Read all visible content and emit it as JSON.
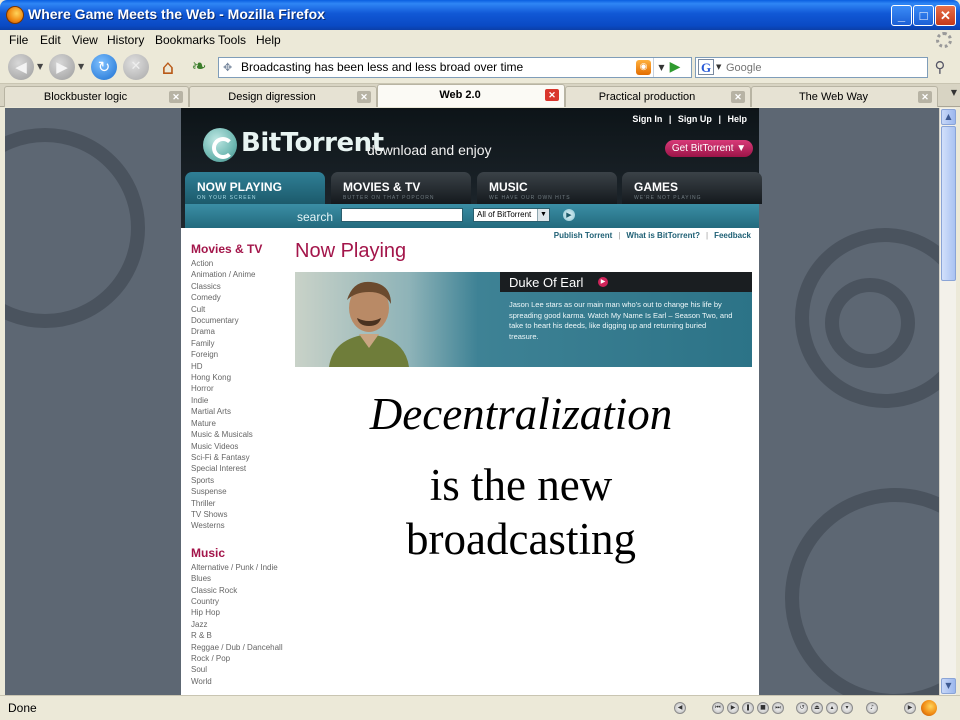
{
  "window": {
    "title": "Where Game Meets the Web - Mozilla Firefox",
    "minimize": "_",
    "maximize": "□",
    "close": "✕"
  },
  "menu": [
    "File",
    "Edit",
    "View",
    "History",
    "Bookmarks",
    "Tools",
    "Help"
  ],
  "toolbar": {
    "url": "Broadcasting has been less and less broad over time",
    "search_placeholder": "Google",
    "search_engine_letter": "G"
  },
  "tabs": [
    {
      "label": "Blockbuster logic",
      "active": false
    },
    {
      "label": "Design digression",
      "active": false
    },
    {
      "label": "Web 2.0",
      "active": true
    },
    {
      "label": "Practical production",
      "active": false
    },
    {
      "label": "The Web Way",
      "active": false
    }
  ],
  "site": {
    "toplinks": [
      "Sign In",
      "|",
      "Sign Up",
      "|",
      "Help"
    ],
    "logo_main": "BitTorrent",
    "tagline": "download and enjoy",
    "get_button": "Get BitTorrent ▼",
    "nav": [
      {
        "label": "NOW PLAYING",
        "sub": "On your screen",
        "active": true
      },
      {
        "label": "MOVIES & TV",
        "sub": "Butter on that popcorn",
        "active": false
      },
      {
        "label": "MUSIC",
        "sub": "We have our own hits",
        "active": false
      },
      {
        "label": "GAMES",
        "sub": "We're not playing",
        "active": false
      }
    ],
    "search_label": "search",
    "search_scope": "All of BitTorrent",
    "sublinks": [
      "Publish Torrent",
      "What is BitTorrent?",
      "Feedback"
    ],
    "sidebar": {
      "movies_heading": "Movies & TV",
      "movies": [
        "Action",
        "Animation / Anime",
        "Classics",
        "Comedy",
        "Cult",
        "Documentary",
        "Drama",
        "Family",
        "Foreign",
        "HD",
        "Hong Kong",
        "Horror",
        "Indie",
        "Martial Arts",
        "Mature",
        "Music & Musicals",
        "Music Videos",
        "Sci-Fi & Fantasy",
        "Special Interest",
        "Sports",
        "Suspense",
        "Thriller",
        "TV Shows",
        "Westerns"
      ],
      "music_heading": "Music",
      "music": [
        "Alternative / Punk / Indie",
        "Blues",
        "Classic Rock",
        "Country",
        "Hip Hop",
        "Jazz",
        "R & B",
        "Reggae / Dub / Dancehall",
        "Rock / Pop",
        "Soul",
        "World"
      ]
    },
    "now_playing_title": "Now Playing",
    "feature": {
      "title": "Duke Of Earl",
      "description": "Jason Lee stars as our main man who's out to change his life by spreading good karma. Watch My Name Is Earl – Season Two, and take to heart his deeds, like digging up and returning buried treasure."
    }
  },
  "overlay": {
    "line1": "Decentralization",
    "line2": "is the new broadcasting"
  },
  "status": {
    "text": "Done"
  },
  "colors": {
    "accent_magenta": "#a3154a",
    "teal": "#2c7387",
    "window_blue": "#0a4ac4"
  }
}
